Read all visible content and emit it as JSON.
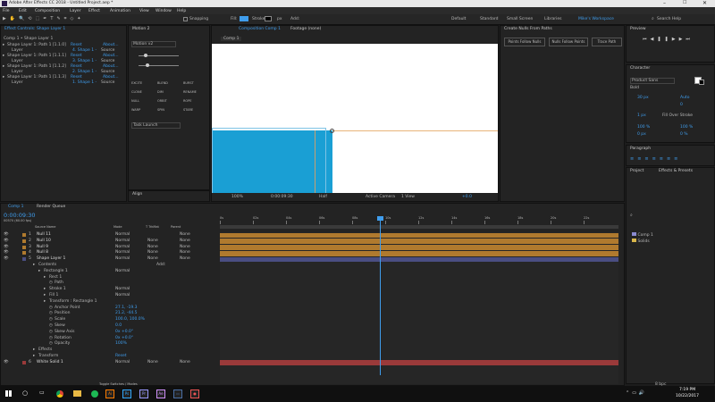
{
  "window": {
    "title": "Adobe After Effects CC 2018 - Untitled Project.aep *"
  },
  "menu": [
    "File",
    "Edit",
    "Composition",
    "Layer",
    "Effect",
    "Animation",
    "View",
    "Window",
    "Help"
  ],
  "toolbar": {
    "snapping": "Snapping",
    "fill": "Fill:",
    "stroke": "Stroke:",
    "stroke_px": "px",
    "add": "Add:"
  },
  "workspaces": [
    "Default",
    "Standard",
    "Small Screen",
    "Libraries",
    "Mike's Workspace"
  ],
  "search_help": {
    "placeholder": "Search Help"
  },
  "effect_controls": {
    "tab": "Effect Controls: Shape Layer 1",
    "breadcrumb": "Comp 1 • Shape Layer 1",
    "rows": [
      {
        "name": "Shape Layer 1: Path 1 [1.1.0]",
        "reset": "Reset",
        "about": "About..."
      },
      {
        "name": "Layer",
        "reset": "",
        "about": "4. Shape 1 -",
        "extra": "Source"
      },
      {
        "name": "Shape Layer 1: Path 1 [1.1.1]",
        "reset": "Reset",
        "about": "About..."
      },
      {
        "name": "Layer",
        "reset": "",
        "about": "3. Shape 1 -",
        "extra": "Source"
      },
      {
        "name": "Shape Layer 1: Path 1 [1.1.2]",
        "reset": "Reset",
        "about": "About..."
      },
      {
        "name": "Layer",
        "reset": "",
        "about": "2. Shape 1 -",
        "extra": "Source"
      },
      {
        "name": "Shape Layer 1: Path 1 [1.1.3]",
        "reset": "Reset",
        "about": "About..."
      },
      {
        "name": "Layer",
        "reset": "",
        "about": "1. Shape 1 -",
        "extra": "Source"
      }
    ]
  },
  "motion": {
    "tab": "Motion 2",
    "preset": "Motion v2",
    "buttons": [
      "EXCITE",
      "BLEND",
      "BURST",
      "CLONE",
      "DIM",
      "RENAME",
      "NULL",
      "ORBIT",
      "ROPE",
      "WARP",
      "SPIN",
      "STARE"
    ],
    "task_launch": "Task Launch"
  },
  "align": {
    "tab": "Align"
  },
  "composition": {
    "tab": "Composition Comp 1",
    "footage_tab": "Footage (none)",
    "subtab": "Comp 1",
    "zoom": "100%",
    "timecode": "0:00:09:30",
    "resolution": "Half",
    "camera": "Active Camera",
    "view": "1 View",
    "exposure": "+0.0"
  },
  "create_nulls": {
    "tab": "Create Nulls From Paths",
    "buttons": [
      "Points Follow Nulls",
      "Nulls Follow Points",
      "Trace Path"
    ]
  },
  "preview": {
    "tab": "Preview"
  },
  "character": {
    "tab": "Character",
    "font": "Product Sans",
    "style": "Bold",
    "size": "30 px",
    "leading": "Auto",
    "tracking": "0",
    "stroke_width": "1 px",
    "vscale": "100 %",
    "hscale": "100 %",
    "baseline": "0 px",
    "tsume": "0 %",
    "stroke_mode": "Fill Over Stroke"
  },
  "paragraph": {
    "tab": "Paragraph"
  },
  "project": {
    "tab": "Project",
    "effects_tab": "Effects & Presets",
    "items": [
      "Comp 1",
      "Solids"
    ],
    "bpc": "8 bpc"
  },
  "timeline": {
    "tab": "Comp 1",
    "render_tab": "Render Queue",
    "timecode": "0:00:09:30",
    "timecode_sub": "00570 (60.00 fps)",
    "headers": [
      "Source Name",
      "Mode",
      "T TrkMat",
      "Parent"
    ],
    "ruler": [
      "0s",
      "02s",
      "04s",
      "06s",
      "08s",
      "10s",
      "12s",
      "14s",
      "16s",
      "18s",
      "20s",
      "22s"
    ],
    "layers": [
      {
        "num": "1",
        "name": "Null 11",
        "mode": "Normal",
        "trk": "",
        "parent": "None"
      },
      {
        "num": "2",
        "name": "Null 10",
        "mode": "Normal",
        "trk": "None",
        "parent": "None"
      },
      {
        "num": "3",
        "name": "Null 9",
        "mode": "Normal",
        "trk": "None",
        "parent": "None"
      },
      {
        "num": "4",
        "name": "Null 8",
        "mode": "Normal",
        "trk": "None",
        "parent": "None"
      },
      {
        "num": "5",
        "name": "Shape Layer 1",
        "mode": "Normal",
        "trk": "None",
        "parent": "None"
      }
    ],
    "props": [
      {
        "label": "Contents",
        "value": "",
        "indent": 1
      },
      {
        "label": "Rectangle 1",
        "value": "Normal",
        "indent": 2
      },
      {
        "label": "Rect 1",
        "value": "",
        "indent": 3
      },
      {
        "label": "Path",
        "value": "",
        "indent": 4
      },
      {
        "label": "Stroke 1",
        "value": "Normal",
        "indent": 3
      },
      {
        "label": "Fill 1",
        "value": "Normal",
        "indent": 3
      },
      {
        "label": "Transform : Rectangle 1",
        "value": "",
        "indent": 3
      },
      {
        "label": "Anchor Point",
        "value": "27.1, -19.3",
        "indent": 4
      },
      {
        "label": "Position",
        "value": "21.2, -44.5",
        "indent": 4
      },
      {
        "label": "Scale",
        "value": "100.0, 100.0%",
        "indent": 4
      },
      {
        "label": "Skew",
        "value": "0.0",
        "indent": 4
      },
      {
        "label": "Skew Axis",
        "value": "0x +0.0°",
        "indent": 4
      },
      {
        "label": "Rotation",
        "value": "0x +0.0°",
        "indent": 4
      },
      {
        "label": "Opacity",
        "value": "100%",
        "indent": 4
      },
      {
        "label": "Effects",
        "value": "",
        "indent": 1
      },
      {
        "label": "Transform",
        "value": "Reset",
        "indent": 1
      }
    ],
    "last_layer": {
      "num": "6",
      "name": "White Solid 1",
      "mode": "Normal",
      "trk": "None",
      "parent": "None"
    },
    "add_label": "Add:",
    "toggle": "Toggle Switches / Modes"
  },
  "taskbar": {
    "time": "7:19 PM",
    "date": "10/22/2017",
    "apps": [
      "ai-icon",
      "ps-icon",
      "pr-icon",
      "ae-icon",
      "media-icon",
      "camera-icon"
    ]
  },
  "colors": {
    "accent": "#3f9ded",
    "null_layer": "#b07a2e",
    "shape_layer": "#4a4e82",
    "solid_layer": "#9a3a3a",
    "blue_shape": "#1a9fd4"
  }
}
